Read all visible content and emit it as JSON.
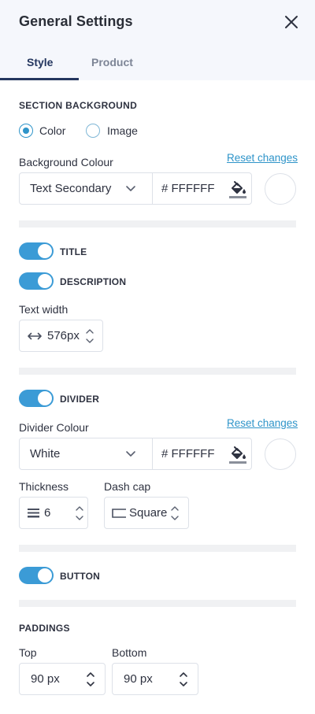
{
  "header": {
    "title": "General Settings",
    "tabs": [
      {
        "label": "Style",
        "active": true
      },
      {
        "label": "Product",
        "active": false
      }
    ]
  },
  "background": {
    "section_title": "SECTION BACKGROUND",
    "options": [
      {
        "label": "Color",
        "selected": true
      },
      {
        "label": "Image",
        "selected": false
      }
    ],
    "colour_label": "Background Colour",
    "reset_label": "Reset changes",
    "colour_value": "Text Secondary",
    "hex_value": "# FFFFFF",
    "swatch_color": "#FFFFFF"
  },
  "title_toggle": {
    "label": "TITLE",
    "on": true
  },
  "description_toggle": {
    "label": "DESCRIPTION",
    "on": true
  },
  "text_width": {
    "label": "Text width",
    "value": "576px"
  },
  "divider": {
    "toggle_label": "DIVIDER",
    "on": true,
    "colour_label": "Divider  Colour",
    "reset_label": "Reset changes",
    "colour_value": "White",
    "hex_value": "# FFFFFF",
    "swatch_color": "#FFFFFF",
    "thickness_label": "Thickness",
    "thickness_value": "6",
    "dashcap_label": "Dash cap",
    "dashcap_value": "Square"
  },
  "button_toggle": {
    "label": "BUTTON",
    "on": true
  },
  "paddings": {
    "section_title": "PADDINGS",
    "top_label": "Top",
    "top_value": "90 px",
    "bottom_label": "Bottom",
    "bottom_value": "90 px"
  },
  "colors": {
    "accent": "#3B9BD6",
    "link": "#2E94C9",
    "tab_active": "#24365F",
    "header_bg": "#F5F7FC"
  },
  "icons": [
    "close-icon",
    "chevron-down-icon",
    "paint-bucket-icon",
    "horizontal-arrows-icon",
    "stepper-arrows-icon",
    "thickness-lines-icon",
    "dash-cap-square-icon"
  ]
}
